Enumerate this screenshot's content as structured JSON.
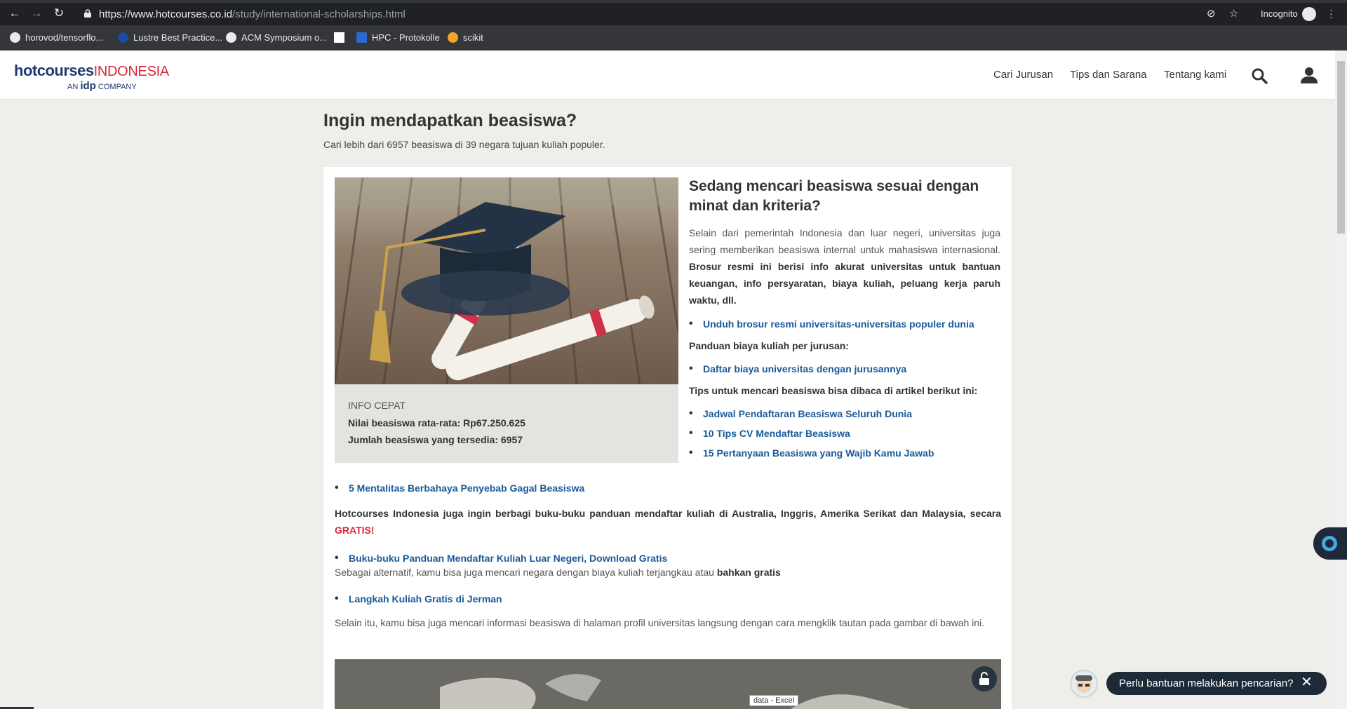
{
  "browser": {
    "url_host": "https://www.hotcourses.co.id",
    "url_path": "/study/international-scholarships.html",
    "incognito_label": "Incognito",
    "bookmarks": [
      {
        "label": "horovod/tensorflo...",
        "icon": "github-icon",
        "color": "#e8eaed"
      },
      {
        "label": "Lustre Best Practice...",
        "icon": "nasa-icon",
        "color": "#1e4aa0"
      },
      {
        "label": "ACM Symposium o...",
        "icon": "globe-icon",
        "color": "#e8eaed"
      },
      {
        "label": "",
        "icon": "blank-page-icon",
        "color": "#ffffff"
      },
      {
        "label": "HPC - Protokolle",
        "icon": "sharepoint-icon",
        "color": "#2a6ad0"
      },
      {
        "label": "scikit",
        "icon": "scikit-icon",
        "color": "#f2a428"
      }
    ]
  },
  "header": {
    "logo_main": "hotcourses",
    "logo_country": "INDONESIA",
    "logo_sub_an": "AN",
    "logo_sub_idp": "idp",
    "logo_sub_company": "COMPANY",
    "nav": [
      "Cari Jurusan",
      "Tips dan Sarana",
      "Tentang kami"
    ]
  },
  "page": {
    "title": "Ingin mendapatkan beasiswa?",
    "subtitle": "Cari lebih dari 6957 beasiswa di 39 negara tujuan kuliah populer.",
    "info": {
      "label": "INFO CEPAT",
      "line1": "Nilai beasiswa rata-rata: Rp67.250.625",
      "line2": "Jumlah beasiswa yang tersedia: 6957"
    },
    "right": {
      "title": "Sedang mencari beasiswa sesuai dengan minat dan kriteria?",
      "para_plain": "Selain dari pemerintah Indonesia dan luar negeri, universitas juga sering memberikan beasiswa internal untuk mahasiswa internasional. ",
      "para_bold": "Brosur resmi ini berisi info akurat universitas untuk bantuan keuangan, info persyaratan, biaya kuliah, peluang kerja paruh waktu, dll.",
      "link_brosur": "Unduh brosur resmi universitas-universitas populer dunia",
      "label_panduan": "Panduan biaya kuliah per jurusan:",
      "link_biaya": "Daftar biaya universitas dengan jurusannya",
      "label_tips": "Tips untuk mencari beasiswa bisa dibaca di artikel berikut ini:",
      "tips_links": [
        "Jadwal Pendaftaran Beasiswa Seluruh Dunia",
        "10 Tips CV Mendaftar Beasiswa",
        "15 Pertanyaan Beasiswa yang Wajib Kamu Jawab"
      ]
    },
    "full": {
      "link_mentalitas": "5 Mentalitas Berbahaya Penyebab Gagal Beasiswa",
      "para_share": "Hotcourses Indonesia juga ingin berbagi buku-buku panduan mendaftar kuliah di Australia, Inggris, Amerika Serikat dan Malaysia, secara ",
      "gratis": "GRATIS!",
      "link_buku": "Buku-buku Panduan Mendaftar Kuliah Luar Negeri, Download Gratis",
      "alt_plain": "Sebagai alternatif, kamu bisa juga mencari negara dengan biaya kuliah terjangkau atau ",
      "alt_bold": "bahkan gratis",
      "link_jerman": "Langkah Kuliah Gratis di Jerman",
      "para_profil": "Selain itu, kamu bisa juga mencari informasi beasiswa di halaman profil universitas langsung dengan cara mengklik tautan pada gambar di bawah ini."
    }
  },
  "overlay": {
    "tooltip": "data - Excel",
    "chat_text": "Perlu bantuan melakukan pencarian?",
    "chat_close": "✕"
  }
}
